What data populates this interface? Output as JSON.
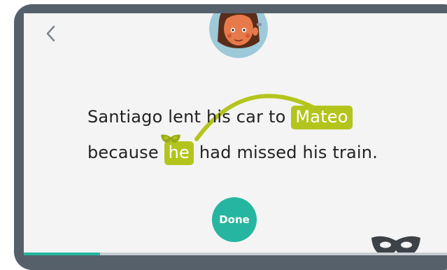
{
  "sentence": {
    "line1_prefix": "Santiago lent his car to",
    "antecedent": "Mateo",
    "line2_prefix": "because",
    "pronoun": "he",
    "line2_suffix": "had missed his train."
  },
  "done_button": {
    "label": "Done"
  },
  "progress": {
    "fraction": 0.18
  },
  "icons": {
    "back": "chevron-left-icon",
    "avatar": "character-avatar",
    "mask": "mask-icon"
  },
  "colors": {
    "highlight": "#b3c51c",
    "accent": "#26b5a0",
    "frame": "#56606b",
    "screen": "#f4f4f4"
  }
}
